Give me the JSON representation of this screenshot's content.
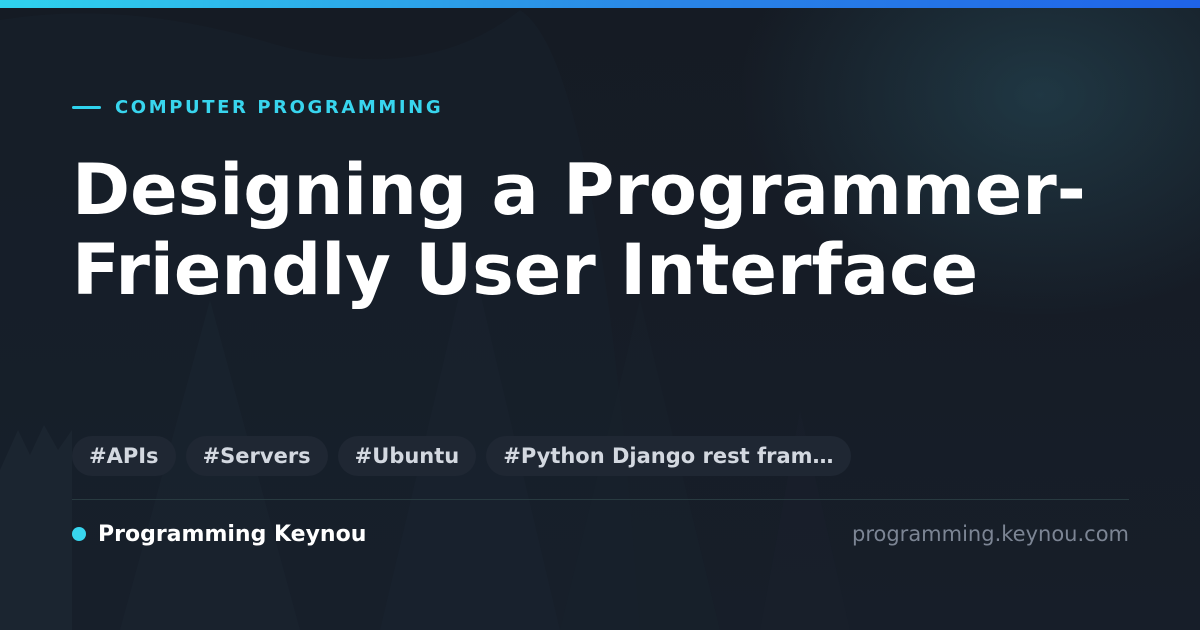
{
  "header": {
    "kicker": "COMPUTER PROGRAMMING",
    "title": "Designing a Programmer-Friendly User Interface"
  },
  "tags": [
    "#APIs",
    "#Servers",
    "#Ubuntu",
    "#Python Django rest fram…"
  ],
  "footer": {
    "site_name": "Programming Keynou",
    "site_url": "programming.keynou.com"
  },
  "colors": {
    "accent": "#38d5ee",
    "background": "#141a24",
    "title": "#ffffff",
    "tag_background": "#1f2733",
    "url": "#7c8594"
  }
}
